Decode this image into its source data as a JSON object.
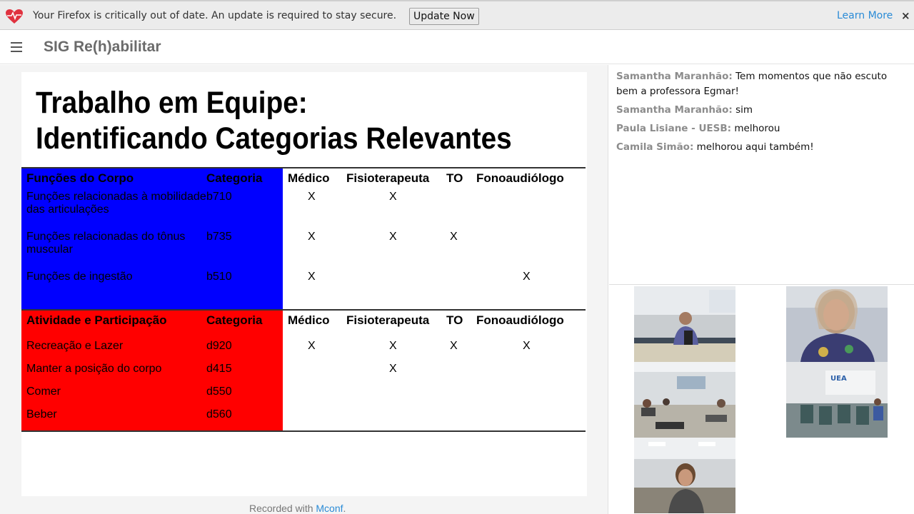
{
  "notification": {
    "message": "Your Firefox is critically out of date. An update is required to stay secure.",
    "update_label": "Update Now",
    "learn_more_label": "Learn More",
    "close_label": "×"
  },
  "header": {
    "title": "SIG Re(h)abilitar"
  },
  "slide": {
    "title_line1": "Trabalho em Equipe:",
    "title_line2": "Identificando Categorias Relevantes",
    "section1": {
      "headers": [
        "Funções do Corpo",
        "Categoria",
        "Médico",
        "Fisioterapeuta",
        "TO",
        "Fonoaudiólogo"
      ],
      "rows": [
        {
          "name": "Funções relacionadas à mobilidade das articulações",
          "code": "b710",
          "medico": "X",
          "fisio": "X",
          "to": "",
          "fono": ""
        },
        {
          "name": "Funções relacionadas do tônus muscular",
          "code": "b735",
          "medico": "X",
          "fisio": "X",
          "to": "X",
          "fono": ""
        },
        {
          "name": "Funções de ingestão",
          "code": "b510",
          "medico": "X",
          "fisio": "",
          "to": "",
          "fono": "X"
        }
      ]
    },
    "section2": {
      "headers": [
        "Atividade e Participação",
        "Categoria",
        "Médico",
        "Fisioterapeuta",
        "TO",
        "Fonoaudiólogo"
      ],
      "rows": [
        {
          "name": "Recreação e Lazer",
          "code": "d920",
          "medico": "X",
          "fisio": "X",
          "to": "X",
          "fono": "X"
        },
        {
          "name": "Manter a posição do corpo",
          "code": "d415",
          "medico": "",
          "fisio": "X",
          "to": "",
          "fono": ""
        },
        {
          "name": "Comer",
          "code": "d550",
          "medico": "",
          "fisio": "",
          "to": "",
          "fono": ""
        },
        {
          "name": "Beber",
          "code": "d560",
          "medico": "",
          "fisio": "",
          "to": "",
          "fono": ""
        }
      ]
    }
  },
  "footer": {
    "prefix": "Recorded with ",
    "link": "Mconf",
    "suffix": "."
  },
  "chat": {
    "messages": [
      {
        "name": "Samantha Maranhão:",
        "text": "Tem momentos que não escuto bem a professora Egmar!"
      },
      {
        "name": "Samantha Maranhão:",
        "text": "sim"
      },
      {
        "name": "Paula Lisiane - UESB:",
        "text": "melhorou"
      },
      {
        "name": "Camila Simão:",
        "text": "melhorou aqui também!"
      }
    ]
  },
  "colors": {
    "body_functions": "#0000ff",
    "activity": "#ff0000",
    "link": "#2a8bd6",
    "chat_name": "#8c8c8c"
  }
}
